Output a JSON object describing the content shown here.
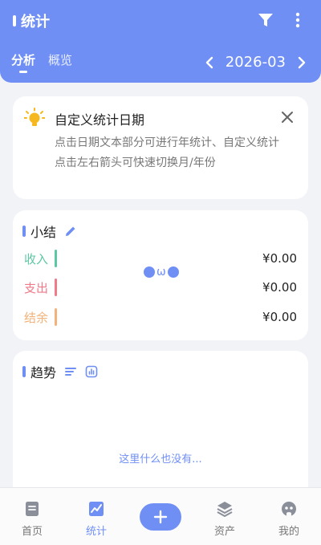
{
  "header": {
    "title": "统计",
    "tabs": [
      {
        "label": "分析",
        "active": true
      },
      {
        "label": "概览",
        "active": false
      }
    ],
    "month": "2026-03"
  },
  "tip": {
    "title": "自定义统计日期",
    "line1": "点击日期文本部分可进行年统计、自定义统计",
    "line2": "点击左右箭头可快速切换月/年份"
  },
  "summary": {
    "title": "小结",
    "face": "ω",
    "rows": [
      {
        "label": "收入",
        "amount": "¥0.00",
        "color": "#5cc7a3"
      },
      {
        "label": "支出",
        "amount": "¥0.00",
        "color": "#ee7a8a"
      },
      {
        "label": "结余",
        "amount": "¥0.00",
        "color": "#f2b27a"
      }
    ]
  },
  "trend": {
    "title": "趋势",
    "empty_text": "这里什么也没有..."
  },
  "nav": {
    "items": [
      {
        "label": "首页",
        "icon": "document-icon",
        "active": false
      },
      {
        "label": "统计",
        "icon": "chart-icon",
        "active": true
      },
      {
        "label": "资产",
        "icon": "layers-icon",
        "active": false
      },
      {
        "label": "我的",
        "icon": "profile-icon",
        "active": false
      }
    ],
    "add_icon": "plus-icon"
  },
  "colors": {
    "accent": "#6f8ff5",
    "income": "#5cc7a3",
    "expense": "#ee7a8a",
    "balance": "#f2b27a"
  }
}
